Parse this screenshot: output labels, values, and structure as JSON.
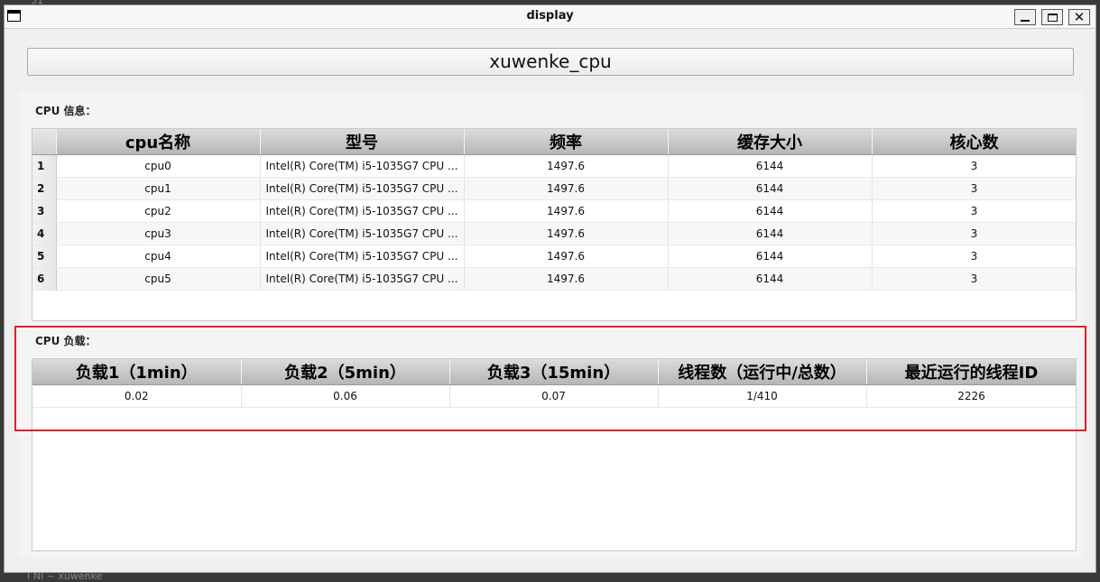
{
  "window": {
    "title": "display",
    "minimize_label": "minimize",
    "maximize_label": "maximize",
    "close_label": "✕"
  },
  "cpu_name_button": "xuwenke_cpu",
  "cpu_info": {
    "label": "CPU 信息：",
    "columns": [
      "cpu名称",
      "型号",
      "频率",
      "缓存大小",
      "核心数"
    ],
    "rows": [
      {
        "num": "1",
        "name": "cpu0",
        "model": "Intel(R) Core(TM) i5-1035G7 CPU ...",
        "freq": "1497.6",
        "cache": "6144",
        "cores": "3"
      },
      {
        "num": "2",
        "name": "cpu1",
        "model": "Intel(R) Core(TM) i5-1035G7 CPU ...",
        "freq": "1497.6",
        "cache": "6144",
        "cores": "3"
      },
      {
        "num": "3",
        "name": "cpu2",
        "model": "Intel(R) Core(TM) i5-1035G7 CPU ...",
        "freq": "1497.6",
        "cache": "6144",
        "cores": "3"
      },
      {
        "num": "4",
        "name": "cpu3",
        "model": "Intel(R) Core(TM) i5-1035G7 CPU ...",
        "freq": "1497.6",
        "cache": "6144",
        "cores": "3"
      },
      {
        "num": "5",
        "name": "cpu4",
        "model": "Intel(R) Core(TM) i5-1035G7 CPU ...",
        "freq": "1497.6",
        "cache": "6144",
        "cores": "3"
      },
      {
        "num": "6",
        "name": "cpu5",
        "model": "Intel(R) Core(TM) i5-1035G7 CPU ...",
        "freq": "1497.6",
        "cache": "6144",
        "cores": "3"
      }
    ]
  },
  "cpu_load": {
    "label": "CPU 负载：",
    "columns": [
      "负载1（1min）",
      "负载2（5min）",
      "负载3（15min）",
      "线程数（运行中/总数）",
      "最近运行的线程ID"
    ],
    "rows": [
      {
        "load1": "0.02",
        "load5": "0.06",
        "load15": "0.07",
        "threads": "1/410",
        "last_pid": "2226"
      }
    ]
  },
  "colors": {
    "highlight_border": "#e0202a",
    "header_gradient_top": "#dcdcdc",
    "header_gradient_bottom": "#b6b6b6"
  }
}
